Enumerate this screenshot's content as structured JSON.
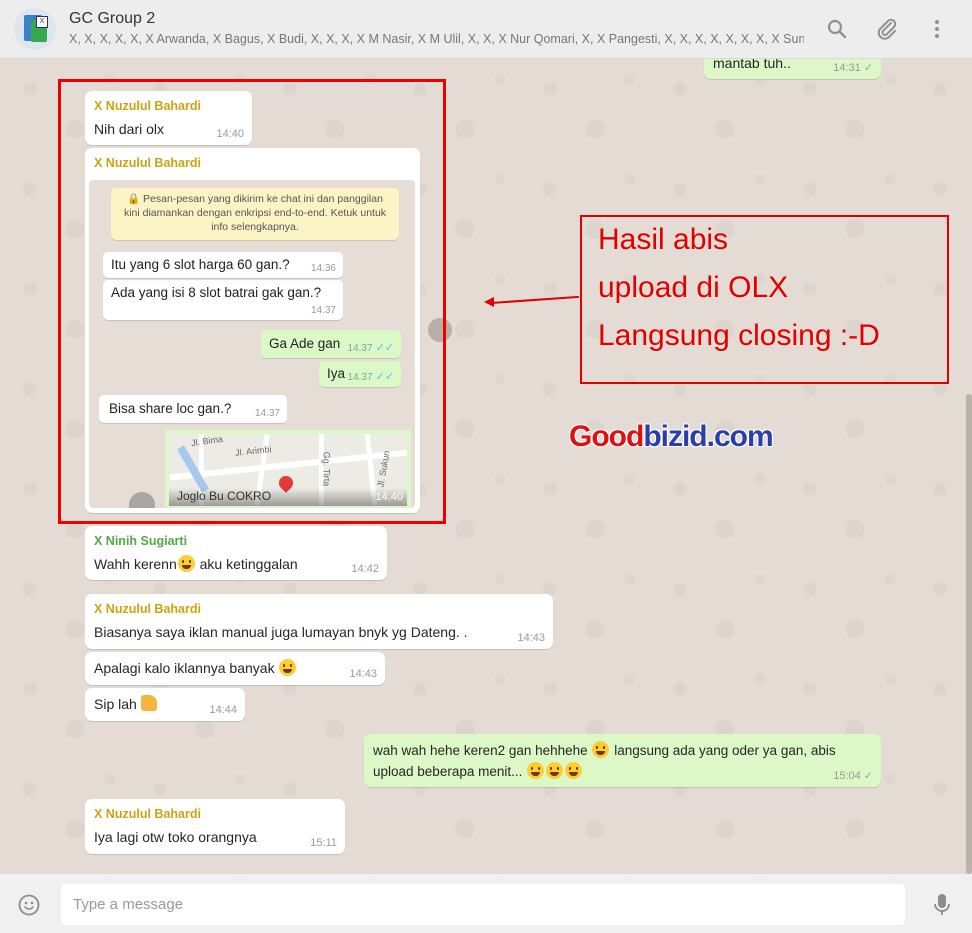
{
  "header": {
    "title": "GC Group 2",
    "participants": "X, X, X, X, X, X Arwanda, X Bagus, X Budi, X, X, X, X M Nasir, X M Ulil, X, X, X Nur Qomari, X, X Pangesti, X, X, X, X, X, X, X, X Suna..."
  },
  "messages": [
    {
      "text": "mantab tuh..",
      "time": "14:31"
    },
    {
      "sender": "X Nuzulul Bahardi",
      "text": "Nih dari olx",
      "time": "14:40"
    },
    {
      "sender": "X Nuzulul Bahardi"
    },
    {
      "sender": "X Ninih Sugiarti",
      "text_before": "Wahh kerenn",
      "text_after": " aku ketinggalan",
      "time": "14:42"
    },
    {
      "sender": "X Nuzulul Bahardi",
      "text": "Biasanya saya iklan manual juga lumayan bnyk yg Dateng. .",
      "time": "14:43"
    },
    {
      "text": "Apalagi kalo iklannya banyak ",
      "time": "14:43"
    },
    {
      "text": "Sip lah ",
      "time": "14:44"
    },
    {
      "line1_before": "wah wah hehe keren2 gan hehhehe ",
      "line1_after": " langsung ada yang oder ya gan, abis",
      "line2": "upload beberapa menit... ",
      "time": "15:04"
    },
    {
      "sender": "X Nuzulul Bahardi",
      "text": "Iya lagi otw toko orangnya",
      "time": "15:11"
    }
  ],
  "screenshot": {
    "encryption_notice": "Pesan-pesan yang dikirim ke chat ini dan panggilan kini diamankan dengan enkripsi end-to-end. Ketuk untuk info selengkapnya.",
    "chats": [
      {
        "text": "Itu yang 6 slot harga 60 gan.?",
        "time": "14.36"
      },
      {
        "text": "Ada yang isi 8 slot batrai gak gan.?",
        "time": "14.37"
      },
      {
        "text": "Ga Ade gan",
        "time": "14.37"
      },
      {
        "text": "Iya",
        "time": "14.37"
      },
      {
        "text": "Bisa share loc gan.?",
        "time": "14.37"
      }
    ],
    "map": {
      "place": "Joglo Bu COKRO",
      "time": "14.40",
      "labels": [
        "Jl. Bima",
        "Jl. Arimbi",
        "Gg. Tirta",
        "Jl. Sukun"
      ]
    }
  },
  "annotation": {
    "lines": [
      "Hasil abis",
      "upload di OLX",
      "Langsung closing :-D"
    ],
    "watermark_part1": "Good",
    "watermark_part2": "bizid.com"
  },
  "composer": {
    "placeholder": "Type a message"
  },
  "colors": {
    "sender_nuzulul": "#c8a414",
    "sender_ninih": "#57a64a",
    "annotation_red": "#e00000"
  }
}
